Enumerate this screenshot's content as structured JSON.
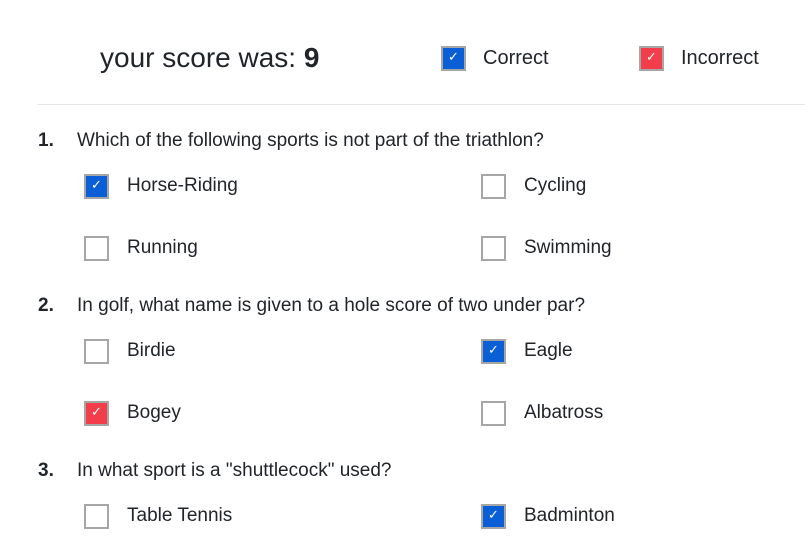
{
  "header": {
    "score_label": "your score was:",
    "score_value": "9",
    "legend": [
      {
        "label": "Correct",
        "state": "correct",
        "icon": "check-icon"
      },
      {
        "label": "Incorrect",
        "state": "incorrect",
        "icon": "check-icon"
      }
    ]
  },
  "colors": {
    "correct": "#0a5fd6",
    "incorrect": "#f23d4a",
    "checkbox_border": "#a6a6a6",
    "text": "#212529",
    "divider": "#e6e6e6"
  },
  "questions": [
    {
      "number": "1.",
      "text": "Which of the following sports is not part of the triathlon?",
      "options": [
        {
          "label": "Horse-Riding",
          "state": "correct"
        },
        {
          "label": "Cycling",
          "state": "none"
        },
        {
          "label": "Running",
          "state": "none"
        },
        {
          "label": "Swimming",
          "state": "none"
        }
      ]
    },
    {
      "number": "2.",
      "text": "In golf, what name is given to a hole score of two under par?",
      "options": [
        {
          "label": "Birdie",
          "state": "none"
        },
        {
          "label": "Eagle",
          "state": "correct"
        },
        {
          "label": "Bogey",
          "state": "incorrect"
        },
        {
          "label": "Albatross",
          "state": "none"
        }
      ]
    },
    {
      "number": "3.",
      "text": "In what sport is a \"shuttlecock\" used?",
      "options": [
        {
          "label": "Table Tennis",
          "state": "none"
        },
        {
          "label": "Badminton",
          "state": "correct"
        }
      ]
    }
  ]
}
